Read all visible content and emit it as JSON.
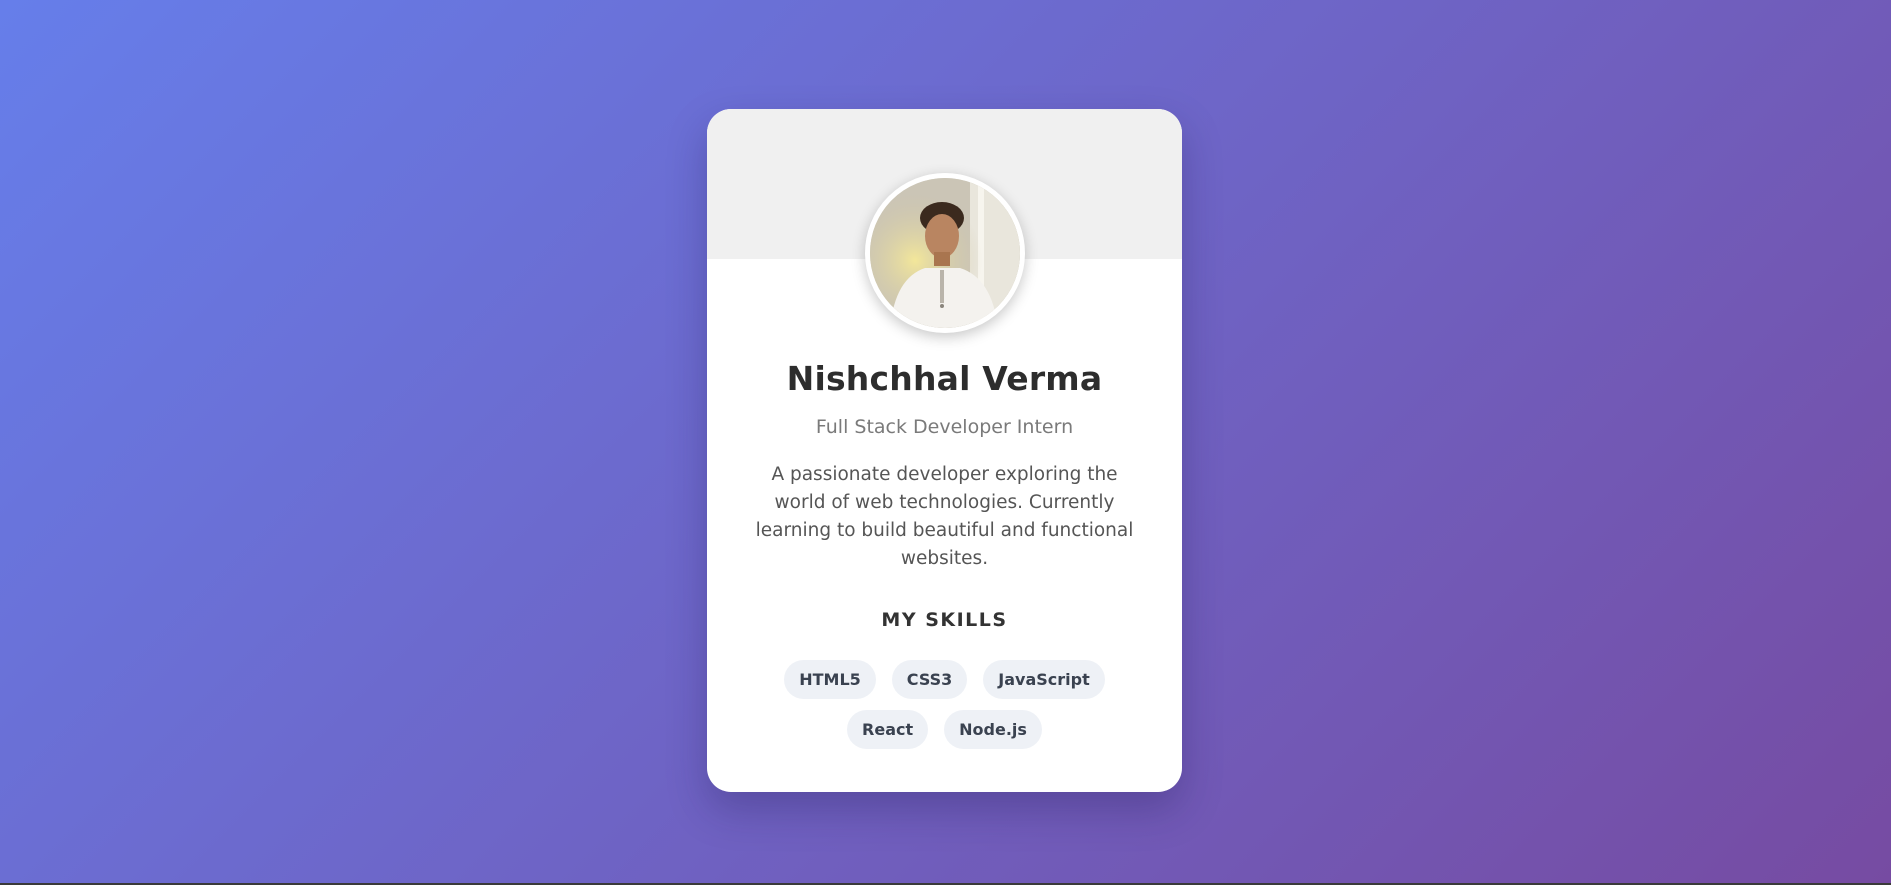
{
  "profile": {
    "name": "Nishchhal Verma",
    "role": "Full Stack Developer Intern",
    "bio": "A passionate developer exploring the world of web technologies. Currently learning to build beautiful and functional websites."
  },
  "skills": {
    "title": "MY SKILLS",
    "items": [
      "HTML5",
      "CSS3",
      "JavaScript",
      "React",
      "Node.js"
    ]
  },
  "colors": {
    "gradient_start": "#667eea",
    "gradient_end": "#764ba2",
    "card_bg": "#ffffff",
    "header_bg": "#f0f0f0",
    "skill_bg": "#eef1f6"
  }
}
